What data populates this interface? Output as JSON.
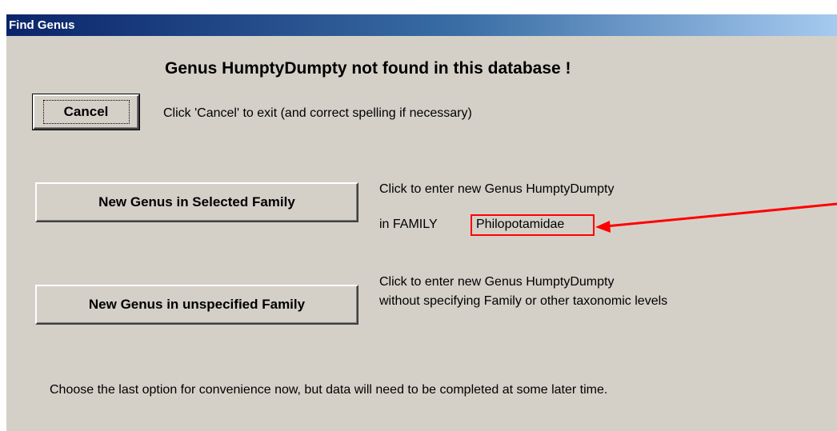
{
  "window": {
    "title": "Find Genus"
  },
  "heading": "Genus HumptyDumpty not found in this database !",
  "cancel": {
    "label": "Cancel",
    "hint": "Click 'Cancel' to exit (and correct spelling if necessary)"
  },
  "option_selected_family": {
    "label": "New Genus in Selected Family",
    "line1": "Click to enter new Genus HumptyDumpty",
    "line2_prefix": "in FAMILY",
    "family": "Philopotamidae"
  },
  "option_unspecified_family": {
    "label": "New Genus in unspecified Family",
    "line1": "Click to enter new Genus HumptyDumpty",
    "line2": "without specifying Family or other taxonomic levels"
  },
  "footer_note": "Choose the last option for convenience now, but data will need to be completed at some later time.",
  "annotation": {
    "color": "#ff0000"
  }
}
